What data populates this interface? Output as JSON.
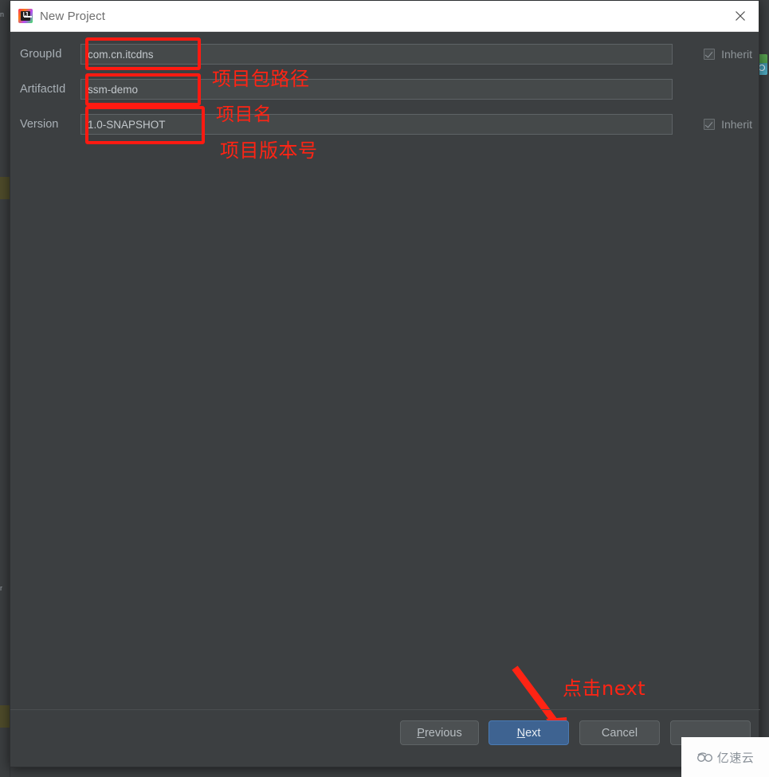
{
  "window": {
    "title": "New Project",
    "app_icon": "intellij-idea-icon",
    "close_icon": "close-icon"
  },
  "form": {
    "rows": [
      {
        "label": "GroupId",
        "value": "com.cn.itcdns",
        "has_inherit": true,
        "inherit_label": "Inherit",
        "inherit_checked": true
      },
      {
        "label": "ArtifactId",
        "value": "ssm-demo",
        "has_inherit": false,
        "inherit_label": "",
        "inherit_checked": false
      },
      {
        "label": "Version",
        "value": "1.0-SNAPSHOT",
        "has_inherit": true,
        "inherit_label": "Inherit",
        "inherit_checked": true
      }
    ]
  },
  "annotations": {
    "color": "#ff2414",
    "group_id_note": "项目包路径",
    "artifact_id_note": "项目名",
    "version_note": "项目版本号",
    "next_note": "点击next"
  },
  "buttons": {
    "previous": "Previous",
    "next": "Next",
    "cancel": "Cancel",
    "help": ""
  },
  "watermark": {
    "text": "亿速云",
    "logo": "cloud-icon"
  }
}
